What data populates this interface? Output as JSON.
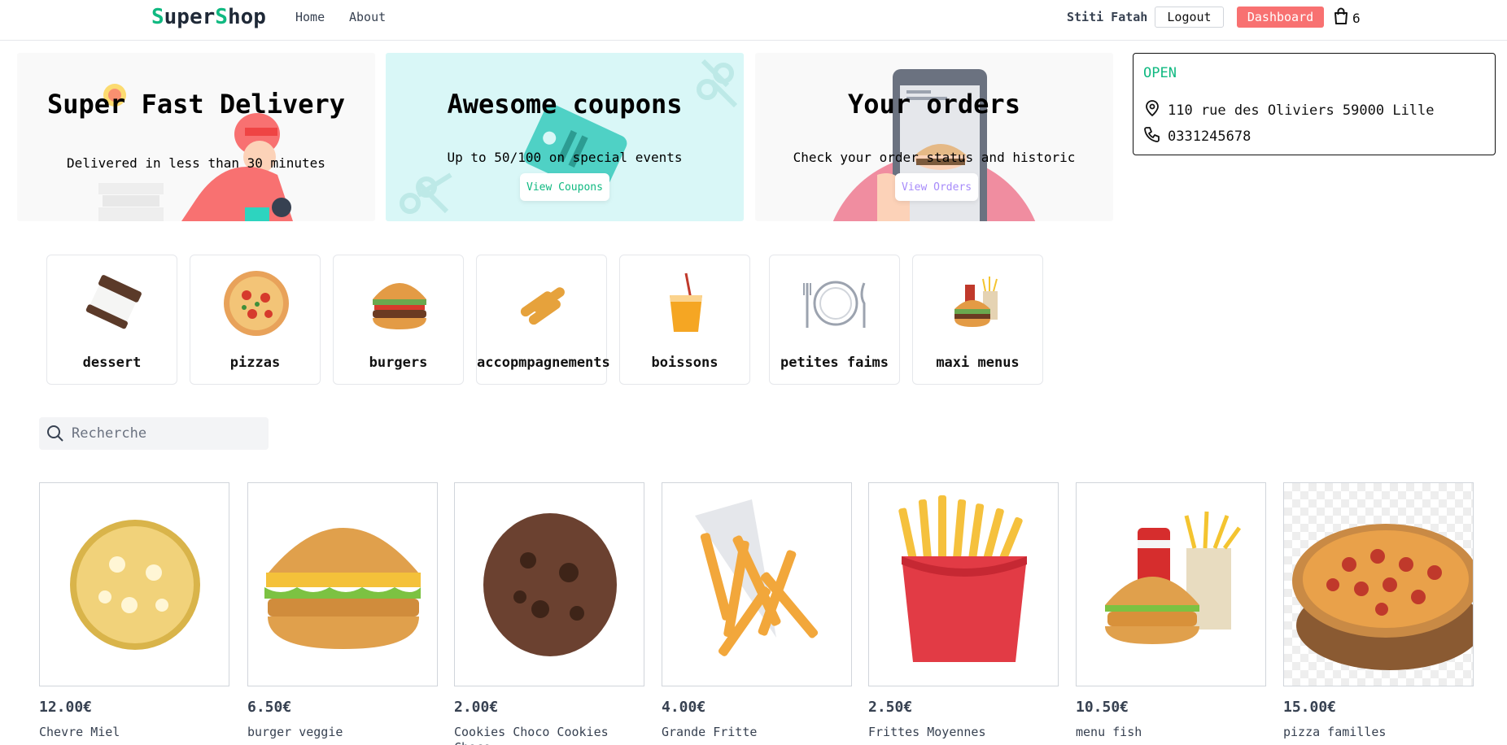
{
  "header": {
    "logo_part1": "Super",
    "logo_part2": "Shop",
    "nav": {
      "home": "Home",
      "about": "About"
    },
    "user_name": "Stiti Fatah",
    "logout_label": "Logout",
    "dashboard_label": "Dashboard",
    "cart_count": "6"
  },
  "hero": [
    {
      "title": "Super Fast Delivery",
      "subtitle": "Delivered in less than 30 minutes",
      "button": ""
    },
    {
      "title": "Awesome coupons",
      "subtitle": "Up to 50/100 on special events",
      "button": "View Coupons"
    },
    {
      "title": "Your orders",
      "subtitle": "Check your order status and historic",
      "button": "View Orders"
    }
  ],
  "shop_info": {
    "status": "OPEN",
    "address": "110 rue des Oliviers 59000 Lille",
    "phone": "0331245678"
  },
  "categories": [
    {
      "label": "dessert",
      "icon": "ice-cream-sandwich-icon"
    },
    {
      "label": "pizzas",
      "icon": "pizza-icon"
    },
    {
      "label": "burgers",
      "icon": "burger-icon"
    },
    {
      "label": "accopmpagnements",
      "icon": "mozzarella-sticks-icon"
    },
    {
      "label": "boissons",
      "icon": "drink-icon"
    },
    {
      "label": "petites faims",
      "icon": "plate-cutlery-icon"
    },
    {
      "label": "maxi menus",
      "icon": "menu-combo-icon"
    }
  ],
  "search": {
    "placeholder": "Recherche"
  },
  "products": [
    {
      "price": "12.00€",
      "name": "Chevre Miel"
    },
    {
      "price": "6.50€",
      "name": "burger veggie"
    },
    {
      "price": "2.00€",
      "name": "Cookies Choco Cookies Choco"
    },
    {
      "price": "4.00€",
      "name": "Grande Fritte"
    },
    {
      "price": "2.50€",
      "name": "Frittes Moyennes"
    },
    {
      "price": "10.50€",
      "name": "menu fish"
    },
    {
      "price": "15.00€",
      "name": "pizza familles"
    }
  ],
  "colors": {
    "accent": "#10b981",
    "dashboard": "#f87171",
    "coupons_bg": "#d9f7f7",
    "orders_link": "#a78bfa",
    "coupons_link": "#10b981"
  }
}
